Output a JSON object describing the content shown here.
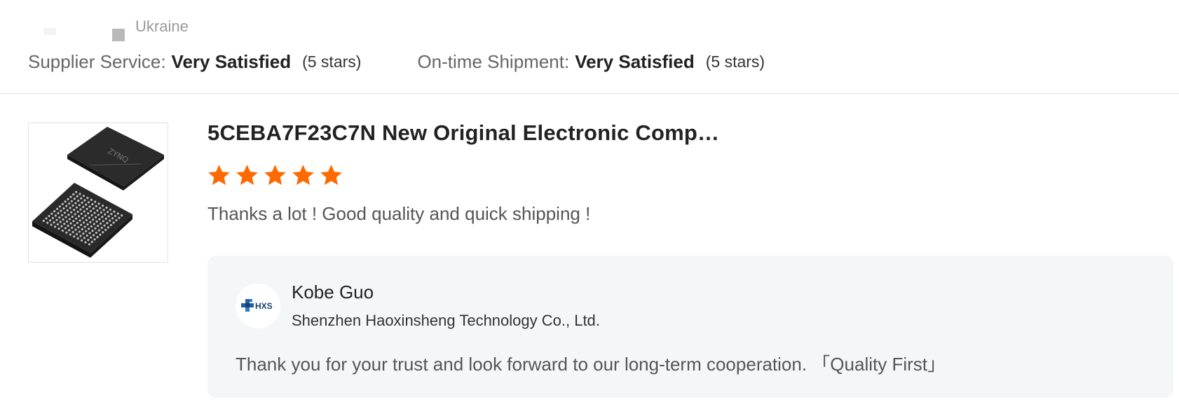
{
  "header": {
    "country": "Ukraine",
    "supplier_service": {
      "label": "Supplier Service:",
      "value": "Very Satisfied",
      "stars_text": "(5 stars)"
    },
    "shipment": {
      "label": "On-time Shipment:",
      "value": "Very Satisfied",
      "stars_text": "(5 stars)"
    }
  },
  "review": {
    "product_image_icon": "chip-image",
    "product_title": "5CEBA7F23C7N New Original Electronic Comp…",
    "rating": 5,
    "rating_max": 5,
    "star_color": "#ff6a00",
    "text": "Thanks a lot ! Good quality and quick shipping !"
  },
  "reply": {
    "logo_text": "HXS",
    "name": "Kobe Guo",
    "company": "Shenzhen Haoxinsheng Technology Co., Ltd.",
    "text": "Thank you for your trust and look forward to our long-term cooperation. 「Quality First」"
  }
}
